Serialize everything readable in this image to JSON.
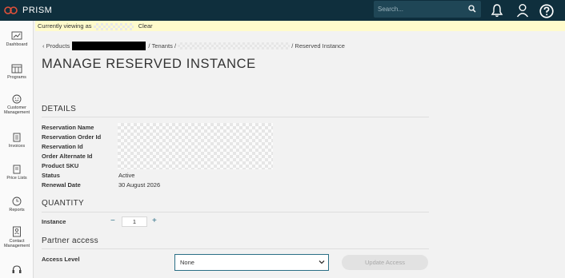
{
  "app": {
    "brand": "PRISM"
  },
  "header": {
    "search_placeholder": "Search..."
  },
  "banner": {
    "prefix": "Currently viewing as",
    "clear": "Clear"
  },
  "sidebar": {
    "items": [
      {
        "label": "Dashboard",
        "icon": "dashboard-icon"
      },
      {
        "label": "Programs",
        "icon": "programs-icon"
      },
      {
        "label": "Customer Management",
        "icon": "customer-icon"
      },
      {
        "label": "Invoices",
        "icon": "invoices-icon"
      },
      {
        "label": "Price Lists",
        "icon": "price-lists-icon"
      },
      {
        "label": "Reports",
        "icon": "reports-icon"
      },
      {
        "label": "Contact Management",
        "icon": "contact-icon"
      }
    ]
  },
  "breadcrumb": {
    "products": "Products",
    "tenants": "Tenants",
    "current": "Reserved Instance"
  },
  "page": {
    "title": "MANAGE RESERVED INSTANCE"
  },
  "details": {
    "heading": "DETAILS",
    "fields": [
      {
        "label": "Reservation Name",
        "value": ""
      },
      {
        "label": "Reservation Order Id",
        "value": ""
      },
      {
        "label": "Reservation Id",
        "value": ""
      },
      {
        "label": "Order Alternate Id",
        "value": ""
      },
      {
        "label": "Product SKU",
        "value": ""
      },
      {
        "label": "Status",
        "value": "Active"
      },
      {
        "label": "Renewal Date",
        "value": "30 August 2026"
      }
    ]
  },
  "quantity": {
    "heading": "QUANTITY",
    "label": "Instance",
    "value": "1",
    "minus": "−",
    "plus": "+"
  },
  "partner": {
    "heading": "Partner access",
    "label": "Access Level",
    "selected": "None",
    "button": "Update Access"
  }
}
